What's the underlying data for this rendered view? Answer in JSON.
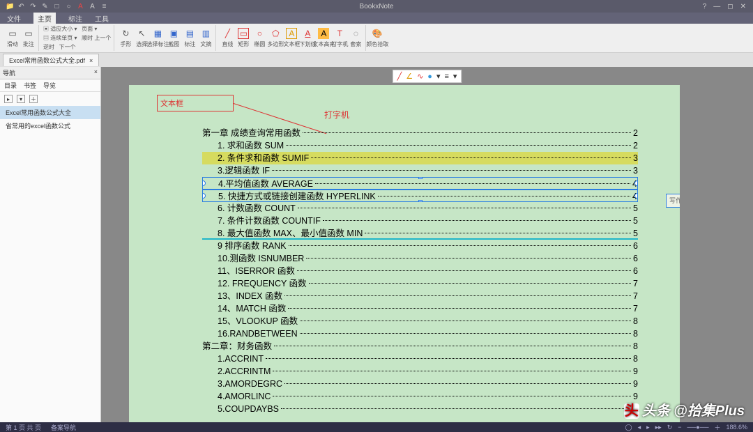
{
  "app": {
    "title": "BookxNote"
  },
  "qat": [
    "📁",
    "↶",
    "↷",
    "✎",
    "□",
    "○",
    "A",
    "A",
    "≡"
  ],
  "win": {
    "min": "—",
    "max": "◻",
    "close": "✕",
    "help": "?"
  },
  "menu": {
    "items": [
      "文件",
      "主页",
      "标注",
      "工具"
    ],
    "active": 1
  },
  "ribbon": {
    "g1": [
      {
        "lb": "滑动"
      },
      {
        "lb": "批注"
      }
    ],
    "pgset": {
      "fit": "适应大小",
      "layout": "连续单页",
      "cw": "顺时",
      "up": "上一个",
      "ccw": "逆时",
      "dn": "下一个",
      "mode": "页面"
    },
    "g2": [
      {
        "lb": "手形"
      },
      {
        "lb": "选择"
      },
      {
        "lb": "选择标注"
      },
      {
        "lb": "截图"
      },
      {
        "lb": "标注"
      },
      {
        "lb": "文摘"
      }
    ],
    "g3": [
      {
        "lb": "直线",
        "c": "r"
      },
      {
        "lb": "矩形",
        "c": "r"
      },
      {
        "lb": "椭圆",
        "c": "r"
      },
      {
        "lb": "多边形",
        "c": "r"
      },
      {
        "lb": "文本框",
        "c": "r"
      },
      {
        "lb": "下划线",
        "c": "r"
      },
      {
        "lb": "文本高亮",
        "c": "r"
      },
      {
        "lb": "打字机",
        "c": "r"
      },
      {
        "lb": "套索"
      }
    ],
    "g4": [
      {
        "lb": "颜色拾取"
      }
    ]
  },
  "doctab": {
    "name": "Excel常用函数公式大全.pdf",
    "close": "×"
  },
  "left": {
    "header": "导航",
    "tabs": [
      "目录",
      "书签",
      "导览"
    ],
    "nodes": [
      "Excel常用函数公式大全",
      "省常用的excel函数公式"
    ]
  },
  "floatbar": {
    "items": [
      "╱",
      "∠",
      "∿",
      "●",
      "≡"
    ]
  },
  "ann": {
    "box": "文本框",
    "typew": "打字机",
    "popup": "写作"
  },
  "toc": [
    {
      "t": "第一章  成绩查询常用函数",
      "pg": "2",
      "chap": true
    },
    {
      "t": "1.  求和函数 SUM",
      "pg": "2"
    },
    {
      "t": "2.  条件求和函数 SUMIF",
      "pg": "3",
      "hl": "y"
    },
    {
      "t": "3.逻辑函数 IF",
      "pg": "3"
    },
    {
      "t": "4.平均值函数 AVERAGE",
      "pg": "4",
      "sel": true
    },
    {
      "t": "5. 快捷方式或链接创建函数 HYPERLINK",
      "pg": "4",
      "sel2": true
    },
    {
      "t": "6.  计数函数 COUNT",
      "pg": "5"
    },
    {
      "t": "7.  条件计数函数 COUNTIF",
      "pg": "5"
    },
    {
      "t": "8.  最大值函数 MAX、最小值函数 MIN",
      "pg": "5",
      "hl": "c"
    },
    {
      "t": "9 排序函数 RANK",
      "pg": "6"
    },
    {
      "t": "10.测函数 ISNUMBER",
      "pg": "6"
    },
    {
      "t": "11、ISERROR 函数",
      "pg": "6"
    },
    {
      "t": "12.  FREQUENCY 函数",
      "pg": "7"
    },
    {
      "t": "13、INDEX 函数",
      "pg": "7"
    },
    {
      "t": "14、MATCH 函数",
      "pg": "7"
    },
    {
      "t": "15、VLOOKUP 函数",
      "pg": "8"
    },
    {
      "t": "16.RANDBETWEEN",
      "pg": "8"
    },
    {
      "t": "第二章：财务函数",
      "pg": "8",
      "chap": true
    },
    {
      "t": "1.ACCRINT",
      "pg": "8"
    },
    {
      "t": "2.ACCRINTM",
      "pg": "9"
    },
    {
      "t": "3.AMORDEGRC",
      "pg": "9"
    },
    {
      "t": "4.AMORLINC",
      "pg": "9"
    },
    {
      "t": "5.COUPDAYBS",
      "pg": "9"
    }
  ],
  "status": {
    "left": [
      "第 1 页 共 页",
      "备案导航"
    ],
    "zoom": "188.6%"
  },
  "watermark": {
    "logo": "头",
    "text": "头条 @拾集Plus"
  }
}
